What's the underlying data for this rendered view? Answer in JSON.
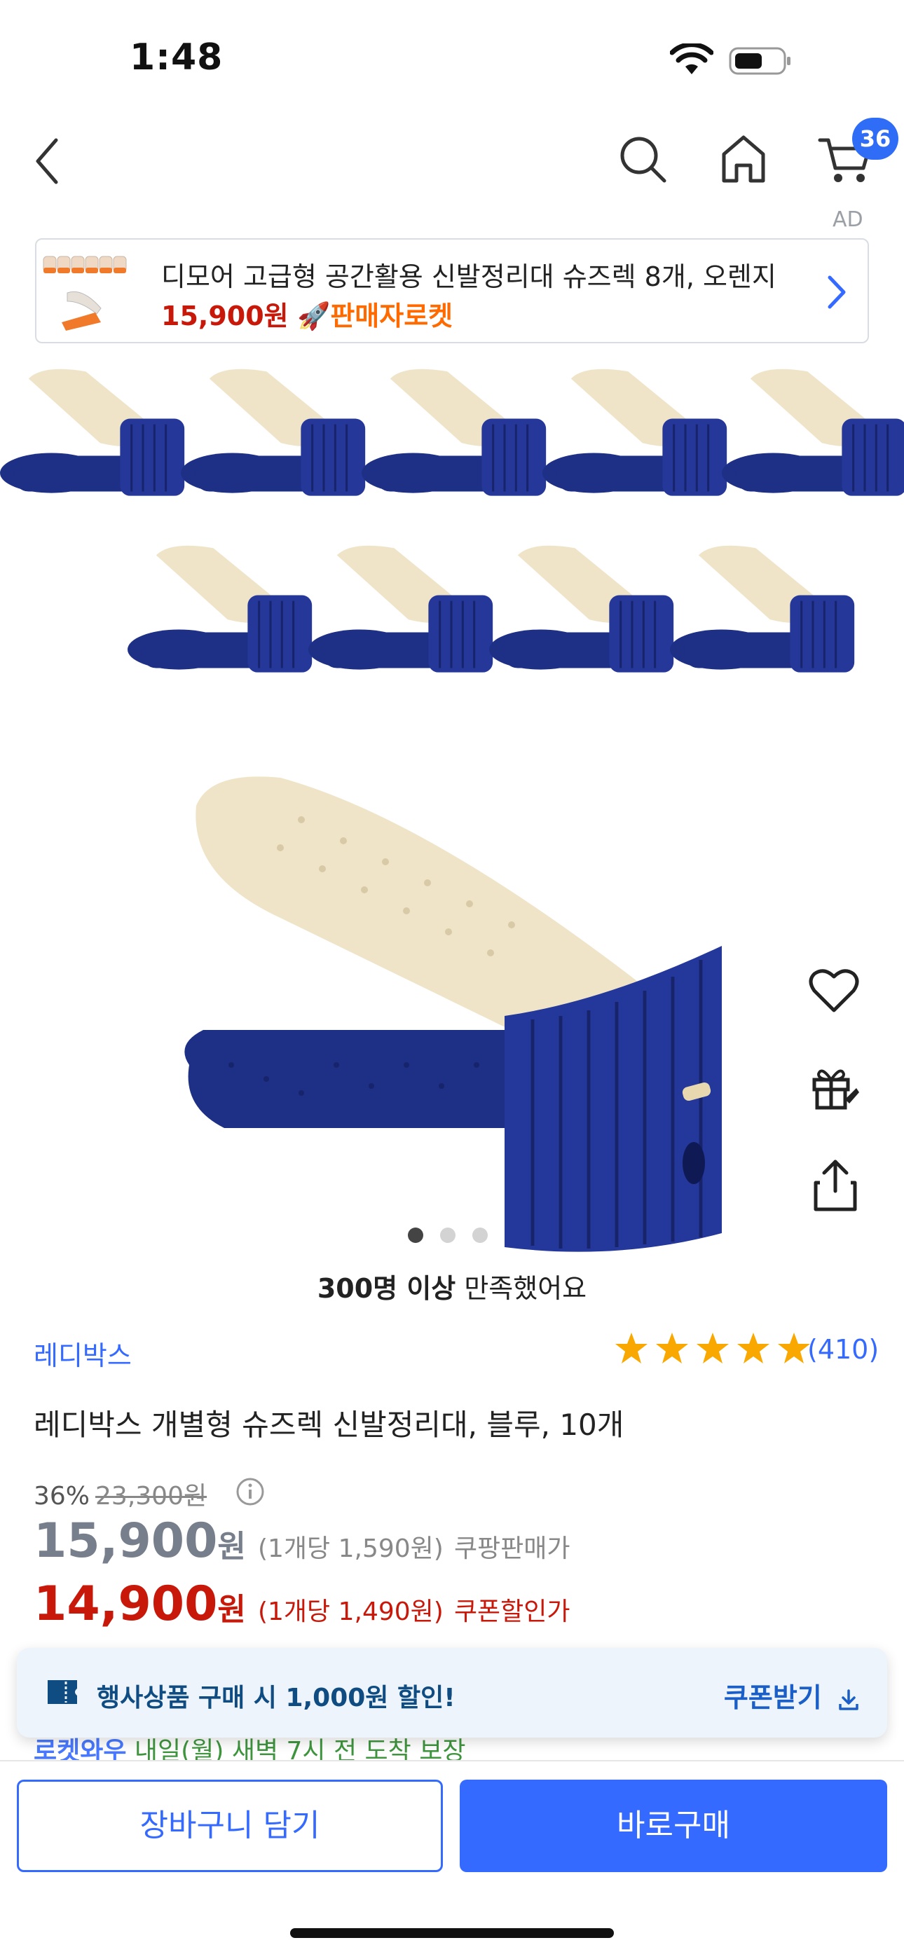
{
  "status_bar": {
    "time": "1:48"
  },
  "nav": {
    "cart_count": "36"
  },
  "ad": {
    "label": "AD",
    "title": "디모어 고급형 공간활용 신발정리대 슈즈렉 8개, 오렌지",
    "price": "15,900원",
    "badge": "🚀판매자로켓"
  },
  "gallery": {
    "total_dots": 3,
    "active_index": 0
  },
  "satisfaction": {
    "bold": "300명 이상",
    "rest": " 만족했어요"
  },
  "product": {
    "brand": "레디박스",
    "rating": 5,
    "reviews": "(410)",
    "title": "레디박스 개별형 슈즈렉 신발정리대, 블루, 10개",
    "discount_pct": "36%",
    "original_price": "23,300원",
    "price_amount": "15,900",
    "price_won": "원",
    "price_unit": "(1개당 1,590원)",
    "price_tag": "쿠팡판매가",
    "coupon_amount": "14,900",
    "coupon_won": "원",
    "coupon_unit": "(1개당 1,490원)",
    "coupon_tag": "쿠폰할인가"
  },
  "coupon_toast": {
    "text": "행사상품 구매 시 1,000원 할인!",
    "button": "쿠폰받기"
  },
  "partial": {
    "bold": "로켓와우",
    "rest": " 내일(월) 새벽 7시 전 도착 보장"
  },
  "bottom": {
    "cart_button": "장바구니 담기",
    "buy_button": "바로구매"
  },
  "colors": {
    "accent": "#346aff",
    "discount_red": "#c8180a",
    "star": "#f8a800",
    "product_navy": "#1e2f86",
    "product_cream": "#efe4c8"
  }
}
